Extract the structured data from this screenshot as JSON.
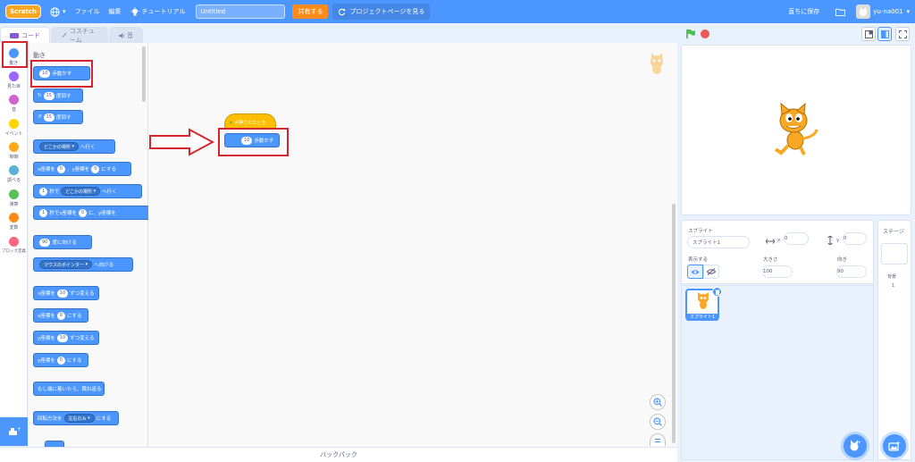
{
  "menubar": {
    "logo": "Scratch",
    "file": "ファイル",
    "edit": "編集",
    "tutorials": "チュートリアル",
    "project_title": "Untitled",
    "share": "共有する",
    "see_project_page": "プロジェクトページを見る",
    "save_now": "直ちに保存",
    "username": "yu-na001"
  },
  "tabs": {
    "code": "コード",
    "costumes": "コスチューム",
    "sounds": "音"
  },
  "categories": [
    {
      "label": "動き",
      "color": "#4c97ff"
    },
    {
      "label": "見た目",
      "color": "#9966ff"
    },
    {
      "label": "音",
      "color": "#cf63cf"
    },
    {
      "label": "イベント",
      "color": "#ffd500"
    },
    {
      "label": "制御",
      "color": "#ffab19"
    },
    {
      "label": "調べる",
      "color": "#5cb1d6"
    },
    {
      "label": "演算",
      "color": "#59c059"
    },
    {
      "label": "変数",
      "color": "#ff8c1a"
    },
    {
      "label": "ブロック定義",
      "color": "#ff6680"
    }
  ],
  "palette": {
    "section": "動き",
    "move_steps": "歩動かす",
    "move_value": "10",
    "turn_right": "度回す",
    "turn_right_value": "15",
    "turn_left": "度回す",
    "turn_left_value": "15",
    "goto_dd": "どこかの場所",
    "goto_suffix": "へ行く",
    "goto_xy_x": "x座標を",
    "goto_xy_x_val": "0",
    "goto_xy_y": "、y座標を",
    "goto_xy_y_val": "0",
    "goto_xy_suffix": "にする",
    "glide_val": "1",
    "glide_mid": "秒で",
    "glide_dd": "どこかの場所",
    "glide_suffix": "へ行く",
    "glide_xy_val": "1",
    "glide_xy_mid": "秒でx座標を",
    "glide_xy_x": "0",
    "glide_xy_y": "に、y座標を",
    "point_dir_val": "90",
    "point_dir": "度に向ける",
    "point_towards_dd": "マウスのポインター",
    "point_towards": "へ向ける",
    "change_x": "x座標を",
    "change_x_val": "10",
    "change_x_suffix": "ずつ変える",
    "set_x": "x座標を",
    "set_x_val": "0",
    "set_x_suffix": "にする",
    "change_y": "y座標を",
    "change_y_val": "10",
    "change_y_suffix": "ずつ変える",
    "set_y": "y座標を",
    "set_y_val": "0",
    "set_y_suffix": "にする",
    "bounce": "もし端に着いたら、跳ね返る",
    "rotation": "回転方法を",
    "rotation_dd": "左右のみ",
    "rotation_suffix": "にする"
  },
  "script": {
    "hat_label": "が押されたとき",
    "move_value": "10",
    "move_label": "歩動かす"
  },
  "backpack": "バックパック",
  "sprite_info": {
    "sprite_label": "スプライト",
    "sprite_name": "スプライト1",
    "x_label": "x",
    "x_value": "0",
    "y_label": "y",
    "y_value": "0",
    "show_label": "表示する",
    "size_label": "大きさ",
    "size_value": "100",
    "direction_label": "向き",
    "direction_value": "90"
  },
  "sprite_list": [
    {
      "name": "スプライト1",
      "selected": true
    }
  ],
  "stage_panel": {
    "title": "ステージ",
    "backdrops_label": "背景",
    "backdrops_count": "1"
  }
}
